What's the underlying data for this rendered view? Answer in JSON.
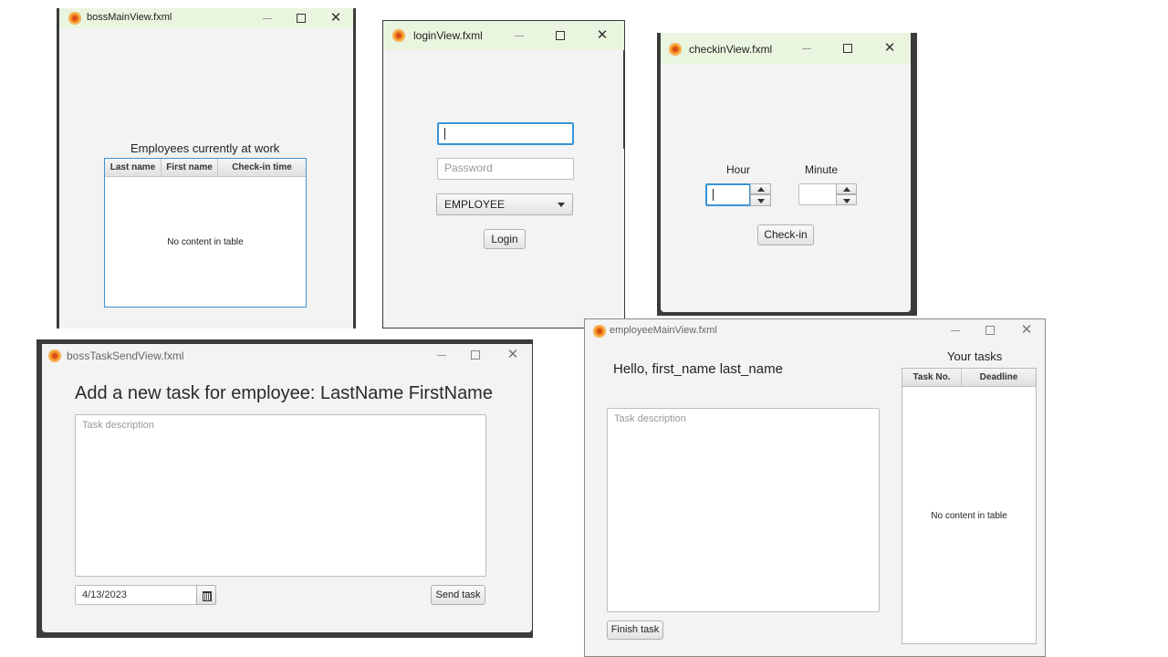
{
  "boss_main": {
    "title": "bossMainView.fxml",
    "header": "Employees currently at work",
    "columns": [
      "Last name",
      "First name",
      "Check-in time"
    ],
    "empty_text": "No content in table"
  },
  "login": {
    "title": "loginView.fxml",
    "username_value": "",
    "password_placeholder": "Password",
    "role_selected": "EMPLOYEE",
    "login_label": "Login"
  },
  "checkin": {
    "title": "checkinView.fxml",
    "hour_label": "Hour",
    "minute_label": "Minute",
    "hour_value": "",
    "minute_value": "",
    "checkin_label": "Check-in"
  },
  "boss_task": {
    "title": "bossTaskSendView.fxml",
    "heading": "Add a new task for employee: LastName FirstName",
    "description_placeholder": "Task description",
    "date_value": "4/13/2023",
    "send_label": "Send task"
  },
  "employee_main": {
    "title": "employeeMainView.fxml",
    "greeting": "Hello, first_name last_name",
    "tasks_header": "Your tasks",
    "columns": [
      "Task No.",
      "Deadline"
    ],
    "empty_text": "No content in table",
    "description_placeholder": "Task description",
    "finish_label": "Finish task"
  },
  "colors": {
    "active_titlebar": "#eaf5df",
    "focus_border": "#3a94d6",
    "table_focus": "#3a94d6"
  }
}
